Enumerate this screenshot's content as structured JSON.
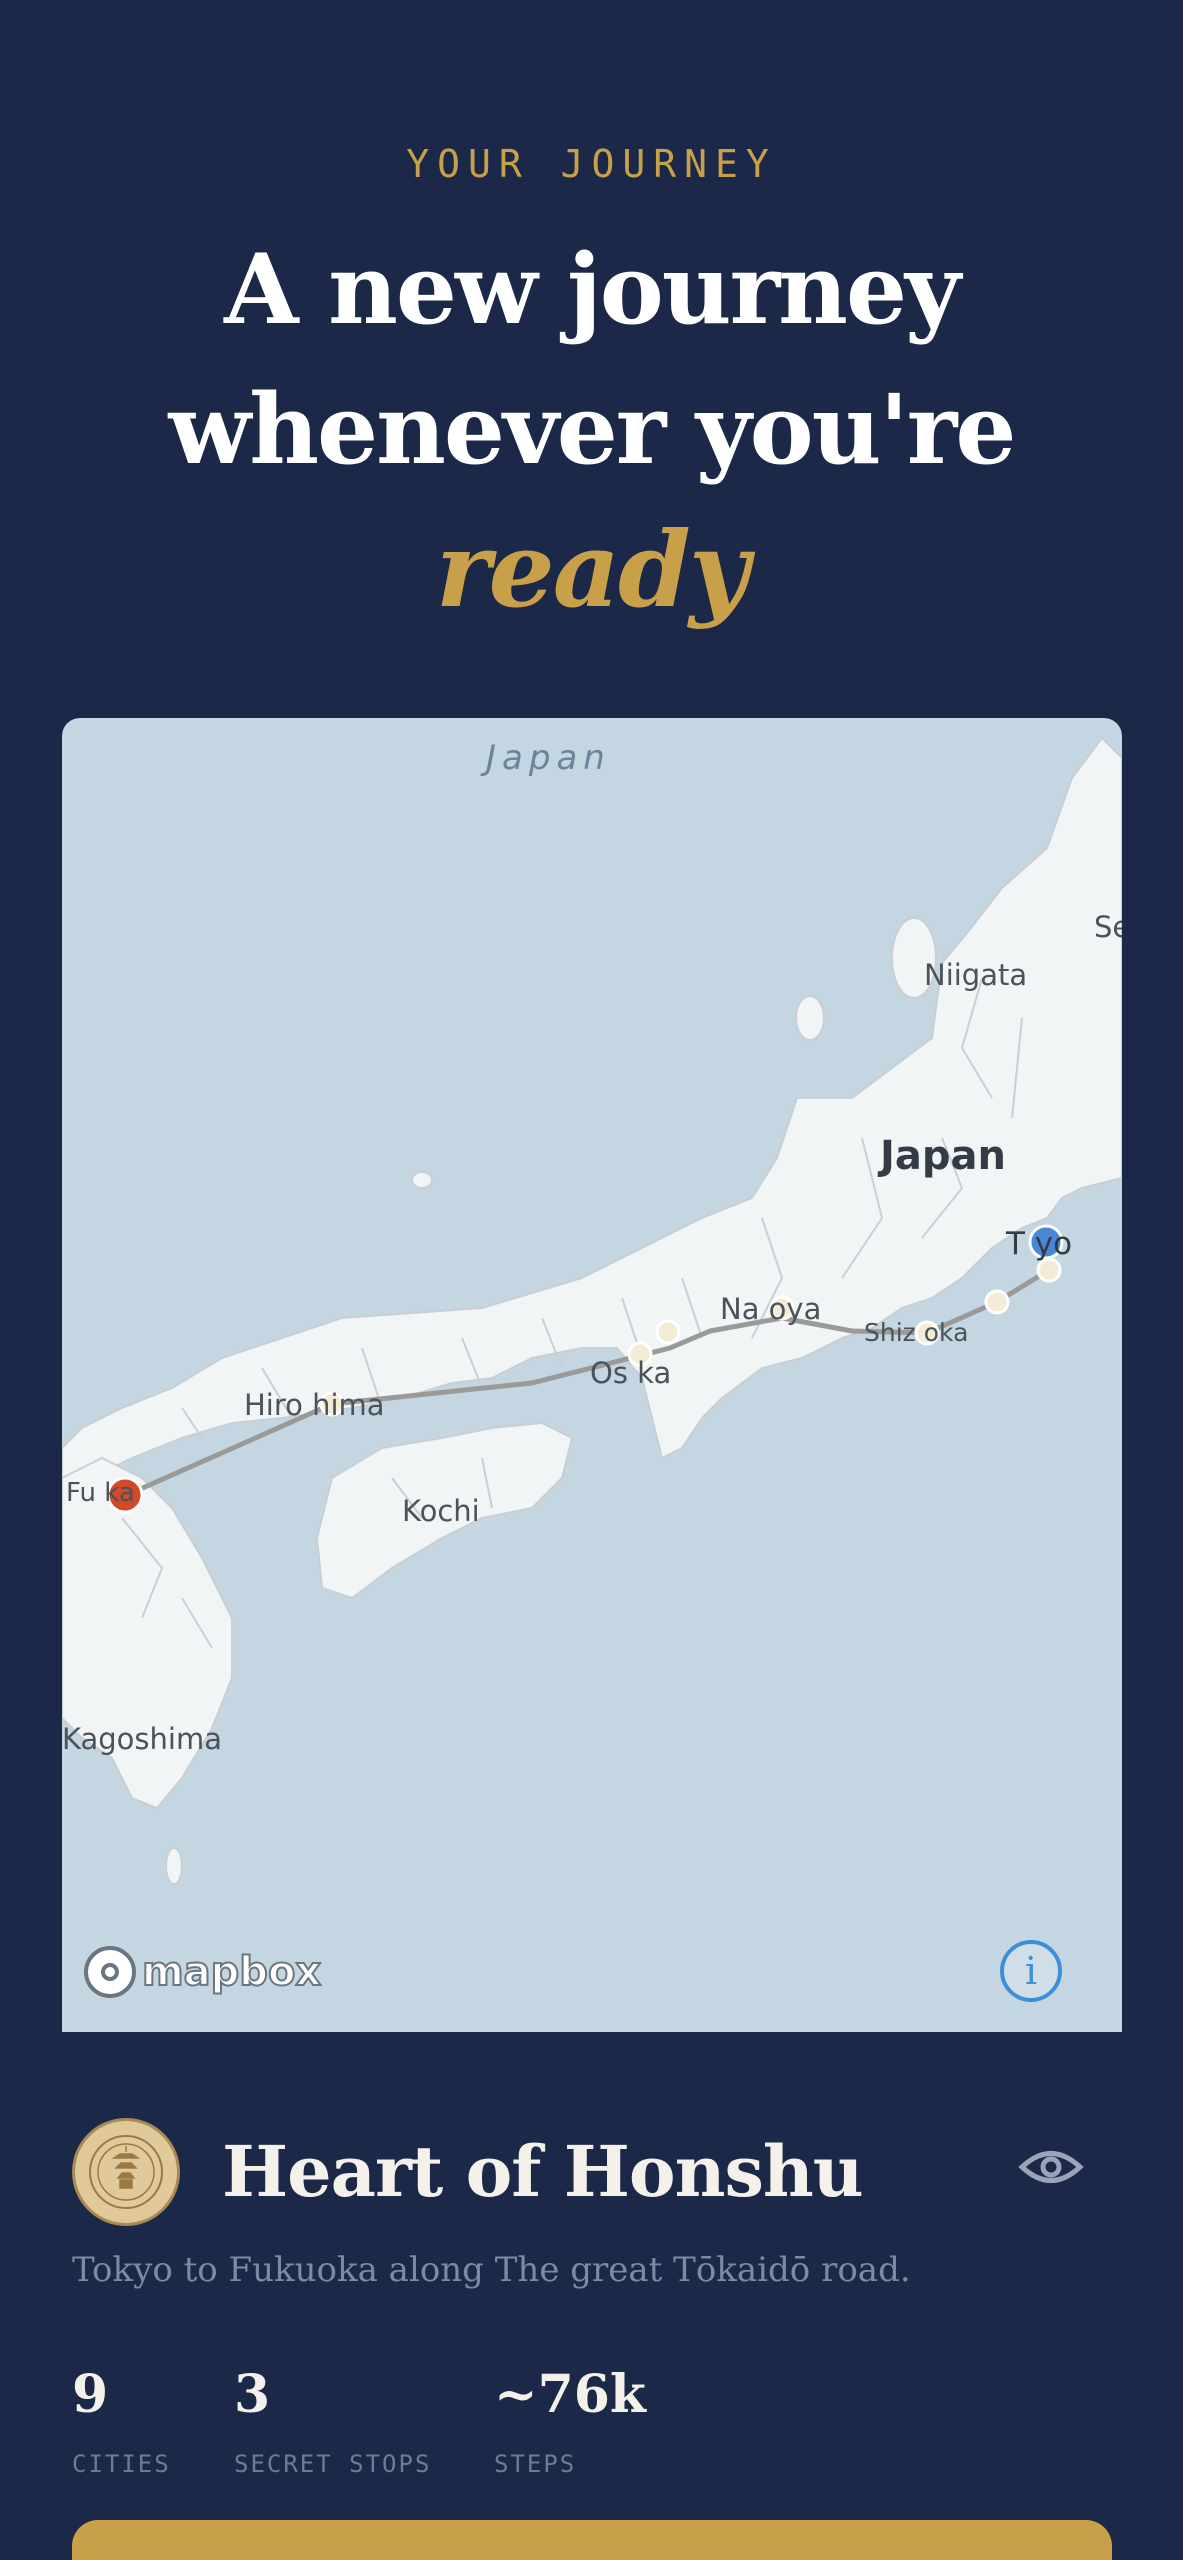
{
  "header": {
    "eyebrow": "YOUR JOURNEY",
    "headline_line1": "A new journey",
    "headline_line2": "whenever you're",
    "headline_accent": "ready"
  },
  "map": {
    "sea_label": "Japan",
    "country_label": "Japan",
    "labels": {
      "se": "Se",
      "niigata": "Niigata",
      "tokyo": "T  yo",
      "nagoya": "Na  oya",
      "shizuoka": "Shiz  oka",
      "osaka": "Os  ka",
      "hiroshima": "Hiro  hima",
      "fukuoka": "Fu   ka",
      "kochi": "Kochi",
      "kagoshima": "Kagoshima"
    },
    "attribution": "mapbox",
    "info_glyph": "i",
    "colors": {
      "water": "#c3d6e2",
      "land": "#f2f5f6",
      "route": "#9a9a98",
      "start": "#4a86d6",
      "end": "#d14a2a",
      "stop": "#f5ecd6"
    }
  },
  "route": {
    "title": "Heart of Honshu",
    "description": "Tokyo to Fukuoka along The great Tōkaidō road.",
    "stats": [
      {
        "value": "9",
        "label": "CITIES"
      },
      {
        "value": "3",
        "label": "SECRET STOPS"
      },
      {
        "value": "~76k",
        "label": "STEPS"
      }
    ]
  },
  "icons": {
    "badge": "pagoda-seal-icon",
    "visibility": "eye-icon"
  },
  "theme": {
    "background": "#1c2847",
    "accent": "#c9a04a"
  }
}
